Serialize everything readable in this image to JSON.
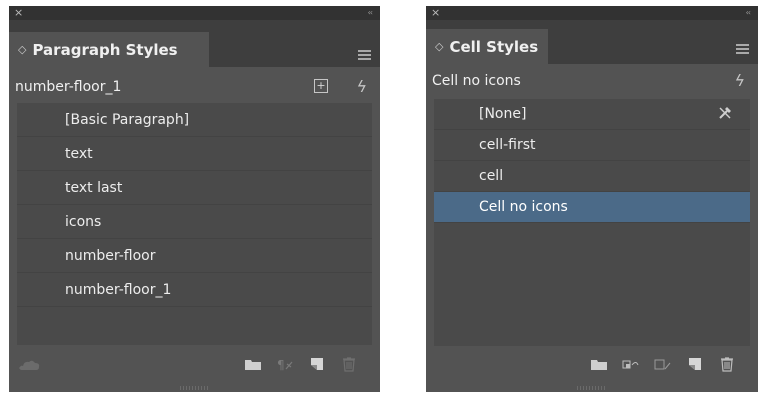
{
  "paragraph_panel": {
    "close_label": "×",
    "collapse_label": "‹‹",
    "tab_arrow": "◇",
    "tab_title": "Paragraph Styles",
    "current_style": "number-floor_1",
    "new_group_glyph": "+",
    "quick_apply_glyph": "ϟ",
    "items": [
      {
        "label": "[Basic Paragraph]"
      },
      {
        "label": "text"
      },
      {
        "label": "text last"
      },
      {
        "label": "icons"
      },
      {
        "label": "number-floor"
      },
      {
        "label": "number-floor_1"
      }
    ]
  },
  "cell_panel": {
    "close_label": "×",
    "collapse_label": "‹‹",
    "tab_arrow": "◇",
    "tab_title": "Cell Styles",
    "current_style": "Cell no icons",
    "quick_apply_glyph": "ϟ",
    "items": [
      {
        "label": "[None]"
      },
      {
        "label": "cell-first"
      },
      {
        "label": "cell"
      },
      {
        "label": "Cell no icons",
        "selected": true
      }
    ]
  },
  "colors": {
    "panel_bg": "#535353",
    "titlebar_bg": "#323232",
    "list_bg": "#4a4a4a",
    "selected_row": "#4b6a88"
  }
}
